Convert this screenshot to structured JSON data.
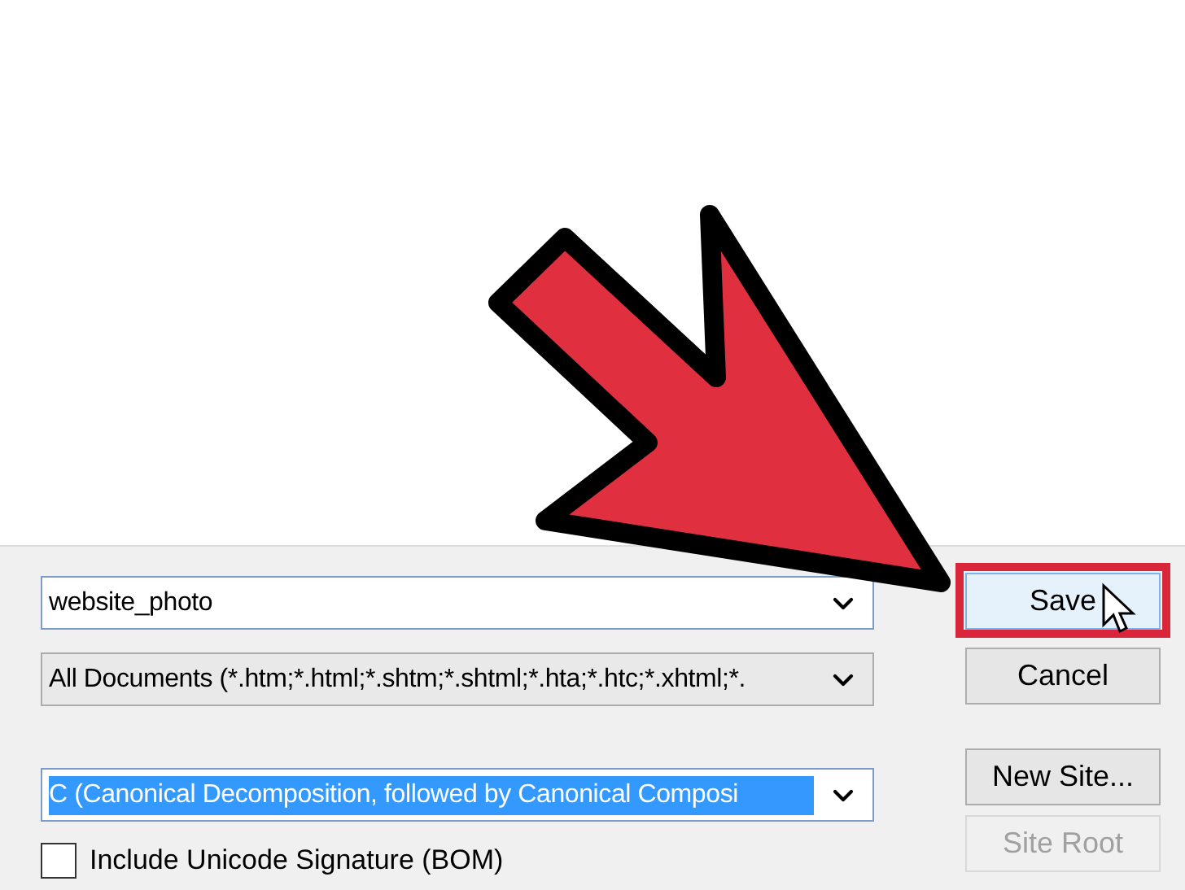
{
  "file_name": {
    "value": "website_photo"
  },
  "file_type": {
    "value": "All Documents (*.htm;*.html;*.shtm;*.shtml;*.hta;*.htc;*.xhtml;*."
  },
  "normalization": {
    "value": "C (Canonical Decomposition, followed by Canonical Composi",
    "selected": true
  },
  "unicode_signature": {
    "label": "Include Unicode Signature (BOM)",
    "checked": false
  },
  "buttons": [
    {
      "label": "Save",
      "highlighted": true,
      "disabled": false
    },
    {
      "label": "Cancel",
      "highlighted": false,
      "disabled": false
    },
    {
      "label": "New Site...",
      "highlighted": false,
      "disabled": false
    },
    {
      "label": "Site Root",
      "highlighted": false,
      "disabled": true
    }
  ]
}
